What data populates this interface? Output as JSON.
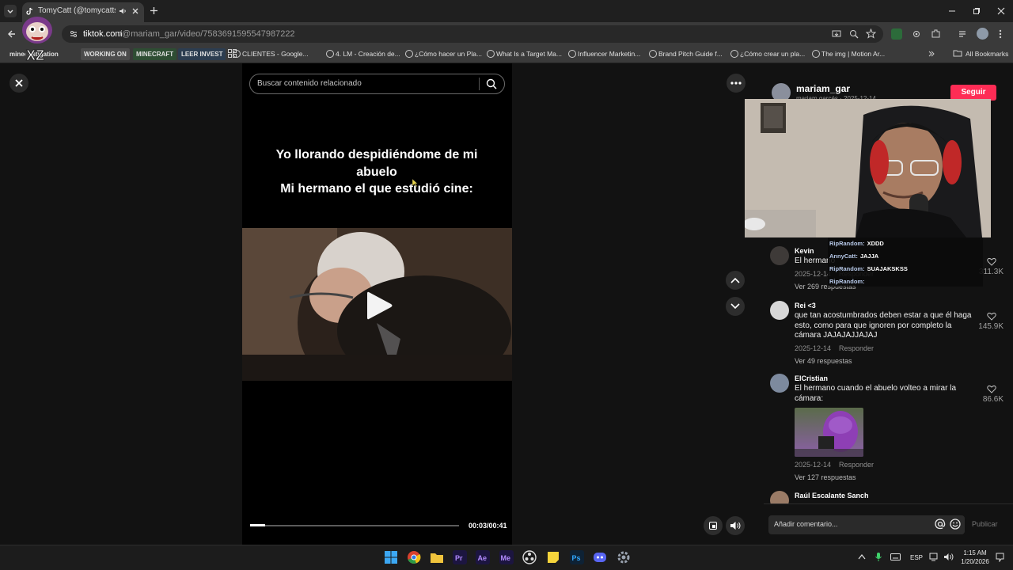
{
  "browser": {
    "tab_title": "TomyCatt (@tomycatts) | Ti",
    "url_host": "tiktok.com",
    "url_path": "/@mariam_gar/video/7583691595547987222",
    "bookmarks": [
      {
        "label": "minecr",
        "tag": true,
        "color": "#3a3a3a"
      },
      {
        "label": "estigation",
        "tag": true,
        "color": "#3a3a3a"
      },
      {
        "label": "WORKING ON",
        "tag": true,
        "color": "#4c4c4c"
      },
      {
        "label": "MINECRAFT",
        "tag": true,
        "color": "#2e4d33"
      },
      {
        "label": "LEER INVEST",
        "tag": true,
        "color": "#2c3d50"
      },
      {
        "label": "CLIENTES - Google...",
        "tag": false
      },
      {
        "label": "4. LM - Creación de...",
        "tag": false
      },
      {
        "label": "¿Cómo hacer un Pla...",
        "tag": false
      },
      {
        "label": "What Is a Target Ma...",
        "tag": false
      },
      {
        "label": "Influencer Marketin...",
        "tag": false
      },
      {
        "label": "Brand Pitch Guide f...",
        "tag": false
      },
      {
        "label": "¿Cómo crear un pla...",
        "tag": false
      },
      {
        "label": "The img | Motion Ar...",
        "tag": false
      }
    ],
    "all_bookmarks": "All Bookmarks"
  },
  "video": {
    "search_placeholder": "Buscar contenido relacionado",
    "caption_line1": "Yo llorando despidiéndome de mi",
    "caption_line2": "abuelo",
    "caption_line3": "Mi hermano el que estudió cine:",
    "time": "00:03/00:41",
    "progress": 0.073
  },
  "author": {
    "username": "mariam_gar",
    "subline": "mariam garcés · 2025-12-14",
    "follow_label": "Seguir"
  },
  "comments": [
    {
      "name": "Kevin",
      "text": "El hermano",
      "date": "2025-12-14",
      "reply": "Responder",
      "likes": "311.3K",
      "more": "Ver 269 respuestas"
    },
    {
      "name": "Rei <3",
      "text": "que tan acostumbrados deben estar a que él haga esto, como para que ignoren por completo la cámara JAJAJAJJAJAJ",
      "date": "2025-12-14",
      "reply": "Responder",
      "likes": "145.9K",
      "more": "Ver 49 respuestas"
    },
    {
      "name": "ElCristian",
      "text": "El hermano cuando el abuelo volteo a mirar la cámara:",
      "date": "2025-12-14",
      "reply": "Responder",
      "likes": "86.6K",
      "more": "Ver 127 respuestas"
    },
    {
      "name": "Raúl Escalante Sanch",
      "text": "",
      "date": "",
      "reply": "",
      "likes": "",
      "more": ""
    }
  ],
  "comment_bar": {
    "placeholder": "Añadir comentario...",
    "publish": "Publicar"
  },
  "chat": [
    {
      "user": "RipRandom:",
      "msg": "XDDD"
    },
    {
      "user": "AnnyCatt:",
      "msg": "JAJJA"
    },
    {
      "user": "RipRandom:",
      "msg": "SUAJAKSKSS"
    },
    {
      "user": "RipRandom:",
      "msg": ""
    }
  ],
  "taskbar": {
    "lang": "ESP",
    "time": "1:15 AM",
    "date": "1/20/2026"
  }
}
